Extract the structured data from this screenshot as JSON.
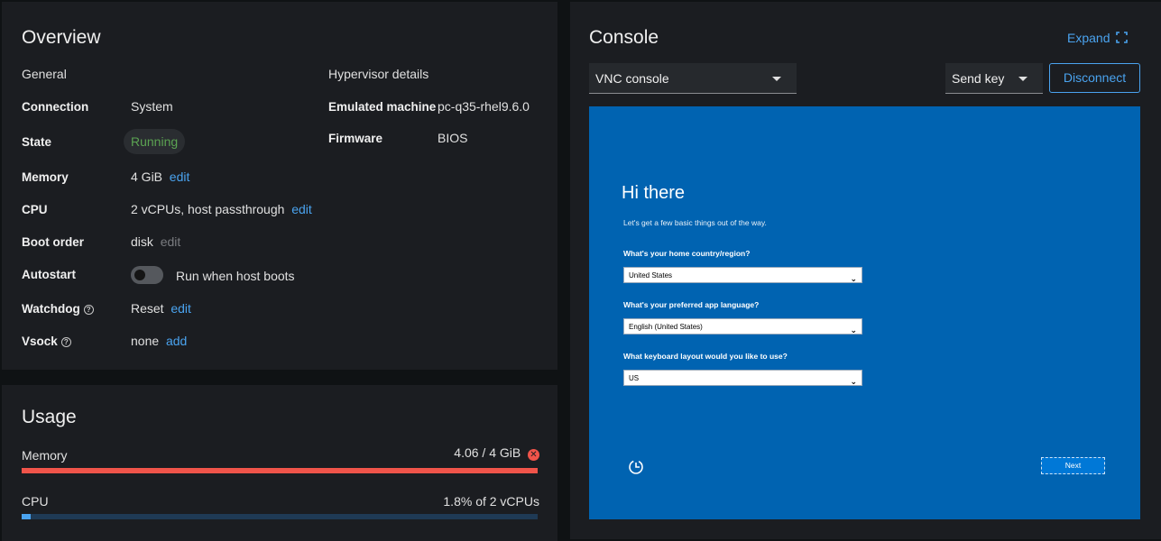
{
  "overview": {
    "title": "Overview",
    "general_heading": "General",
    "hypervisor_heading": "Hypervisor details",
    "rows": {
      "connection": {
        "label": "Connection",
        "value": "System"
      },
      "state": {
        "label": "State",
        "value": "Running"
      },
      "memory": {
        "label": "Memory",
        "value": "4 GiB",
        "action": "edit"
      },
      "cpu": {
        "label": "CPU",
        "value": "2 vCPUs, host passthrough",
        "action": "edit"
      },
      "boot_order": {
        "label": "Boot order",
        "value": "disk",
        "action": "edit"
      },
      "autostart": {
        "label": "Autostart",
        "toggle_label": "Run when host boots",
        "enabled": false
      },
      "watchdog": {
        "label": "Watchdog",
        "value": "Reset",
        "action": "edit"
      },
      "vsock": {
        "label": "Vsock",
        "value": "none",
        "action": "add"
      }
    },
    "hypervisor": {
      "emulated_machine": {
        "label": "Emulated machine",
        "value": "pc-q35-rhel9.6.0"
      },
      "firmware": {
        "label": "Firmware",
        "value": "BIOS"
      }
    }
  },
  "usage": {
    "title": "Usage",
    "memory": {
      "label": "Memory",
      "value_text": "4.06 / 4 GiB",
      "fraction": 1.0,
      "color": "#f0544a"
    },
    "cpu": {
      "label": "CPU",
      "value_text": "1.8% of 2 vCPUs",
      "fraction": 0.018,
      "color": "#4aa3ef"
    }
  },
  "console": {
    "title": "Console",
    "expand_label": "Expand",
    "console_type": "VNC console",
    "send_key_label": "Send key",
    "disconnect_label": "Disconnect",
    "vnc": {
      "title": "Hi there",
      "subtitle": "Let's get a few basic things out of the way.",
      "q_region": "What's your home country/region?",
      "region_value": "United States",
      "q_language": "What's your preferred app language?",
      "language_value": "English (United States)",
      "q_keyboard": "What keyboard layout would you like to use?",
      "keyboard_value": "US",
      "next_label": "Next"
    }
  },
  "icons": {
    "help": "question-circle-icon",
    "error": "times-circle-icon",
    "expand": "expand-icon",
    "caret": "caret-down-icon",
    "accessibility": "ease-of-access-icon"
  },
  "colors": {
    "background": "#0f1214",
    "card": "#1b1d21",
    "link": "#4aa3ef",
    "running": "#5ba352",
    "danger": "#f0544a",
    "vnc_bg": "#0063b1"
  }
}
